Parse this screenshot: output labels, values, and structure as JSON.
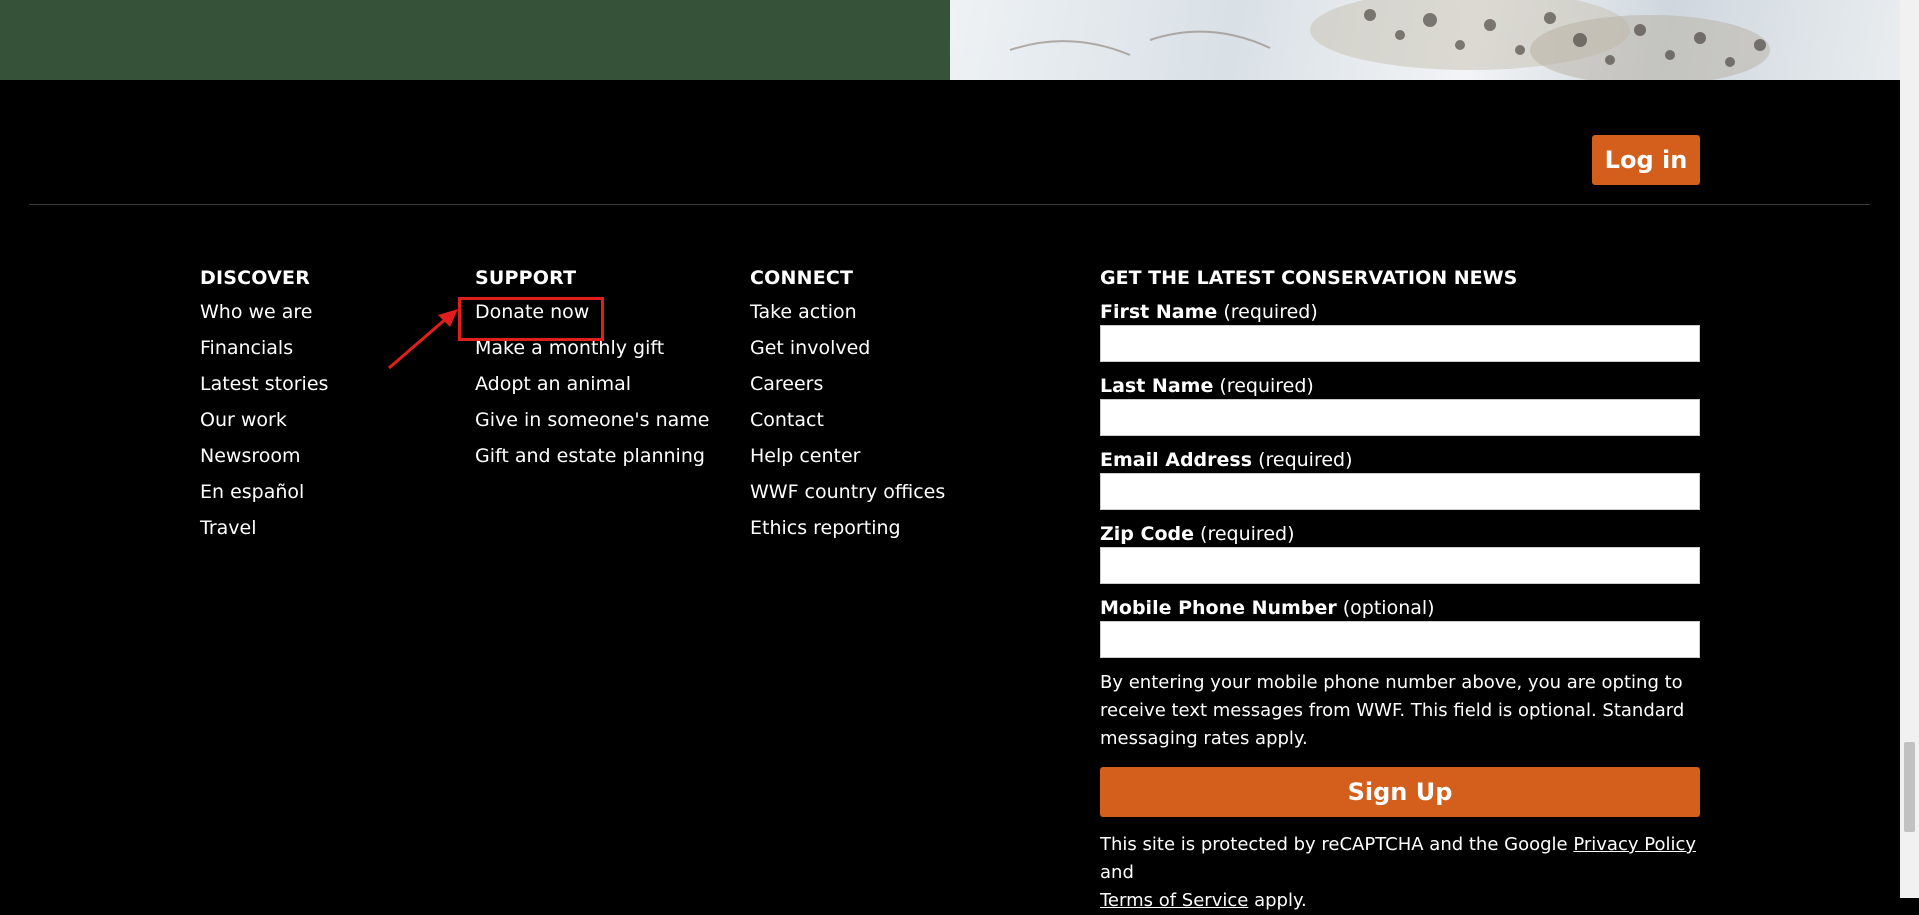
{
  "header": {
    "login_label": "Log in"
  },
  "footer": {
    "discover": {
      "heading": "DISCOVER",
      "links": [
        "Who we are",
        "Financials",
        "Latest stories",
        "Our work",
        "Newsroom",
        "En español",
        "Travel"
      ]
    },
    "support": {
      "heading": "SUPPORT",
      "links": [
        "Donate now",
        "Make a monthly gift",
        "Adopt an animal",
        "Give in someone's name",
        "Gift and estate planning"
      ]
    },
    "connect": {
      "heading": "CONNECT",
      "links": [
        "Take action",
        "Get involved",
        "Careers",
        "Contact",
        "Help center",
        "WWF country offices",
        "Ethics reporting"
      ]
    },
    "newsletter": {
      "heading": "GET THE LATEST CONSERVATION NEWS",
      "fields": [
        {
          "label": "First Name",
          "note": "(required)",
          "value": ""
        },
        {
          "label": "Last Name",
          "note": "(required)",
          "value": ""
        },
        {
          "label": "Email Address",
          "note": "(required)",
          "value": ""
        },
        {
          "label": "Zip Code",
          "note": "(required)",
          "value": ""
        },
        {
          "label": "Mobile Phone Number",
          "note": "(optional)",
          "value": ""
        }
      ],
      "disclaimer": "By entering your mobile phone number above, you are opting to receive text messages from WWF. This field is optional. Standard messaging rates apply.",
      "signup_label": "Sign Up",
      "recaptcha_prefix": "This site is protected by reCAPTCHA and the Google",
      "privacy_link": "Privacy Policy",
      "recaptcha_and": "and",
      "terms_link": "Terms of Service",
      "recaptcha_suffix": "apply."
    }
  },
  "colors": {
    "accent": "#d45e1c",
    "green_band": "#365239",
    "highlight": "#e01e1e"
  }
}
